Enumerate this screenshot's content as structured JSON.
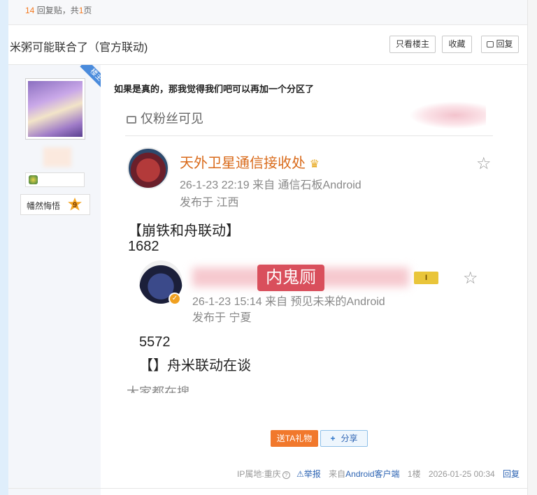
{
  "top": {
    "reply_count": "14",
    "reply_text": "回复贴，共",
    "page_count": "1",
    "page_unit": "页"
  },
  "thread": {
    "title": "米粥可能联合了（官方联动)"
  },
  "toolbar": {
    "only_op": "只看楼主",
    "favorite": "收藏",
    "reply": "回复"
  },
  "author": {
    "op_ribbon": "楼主",
    "level_name": "幡然悔悟",
    "level": "9"
  },
  "post": {
    "text": "如果是真的，那我觉得我们吧可以再加一个分区了",
    "screenshot": {
      "visibility": "仅粉丝可见",
      "user1": "天外卫星通信接收处",
      "user1_meta": "26-1-23 22:19  来自 通信石板Android",
      "user1_loc": "发布于 江西",
      "line1": "【崩铁和舟联动】",
      "line2": "1682",
      "stamp": "内鬼厕",
      "user2_tag": "I",
      "user2_meta": "26-1-23 15:14  来自 预见未来的Android",
      "user2_loc": "发布于 宁夏",
      "line3": "5572",
      "line4": "【】舟米联动在谈",
      "line5": "大家都在搜"
    },
    "gift_button": "送TA礼物",
    "share_button": "分享"
  },
  "footer": {
    "ip": "IP属地:重庆",
    "report": "举报",
    "from_prefix": "来自",
    "client": "Android客户端",
    "floor": "1楼",
    "time": "2026-01-25 00:34",
    "reply": "回复"
  },
  "colors": {
    "accent": "#f1782c",
    "link": "#2d64b3",
    "sidebar": "#f4f6fa"
  }
}
